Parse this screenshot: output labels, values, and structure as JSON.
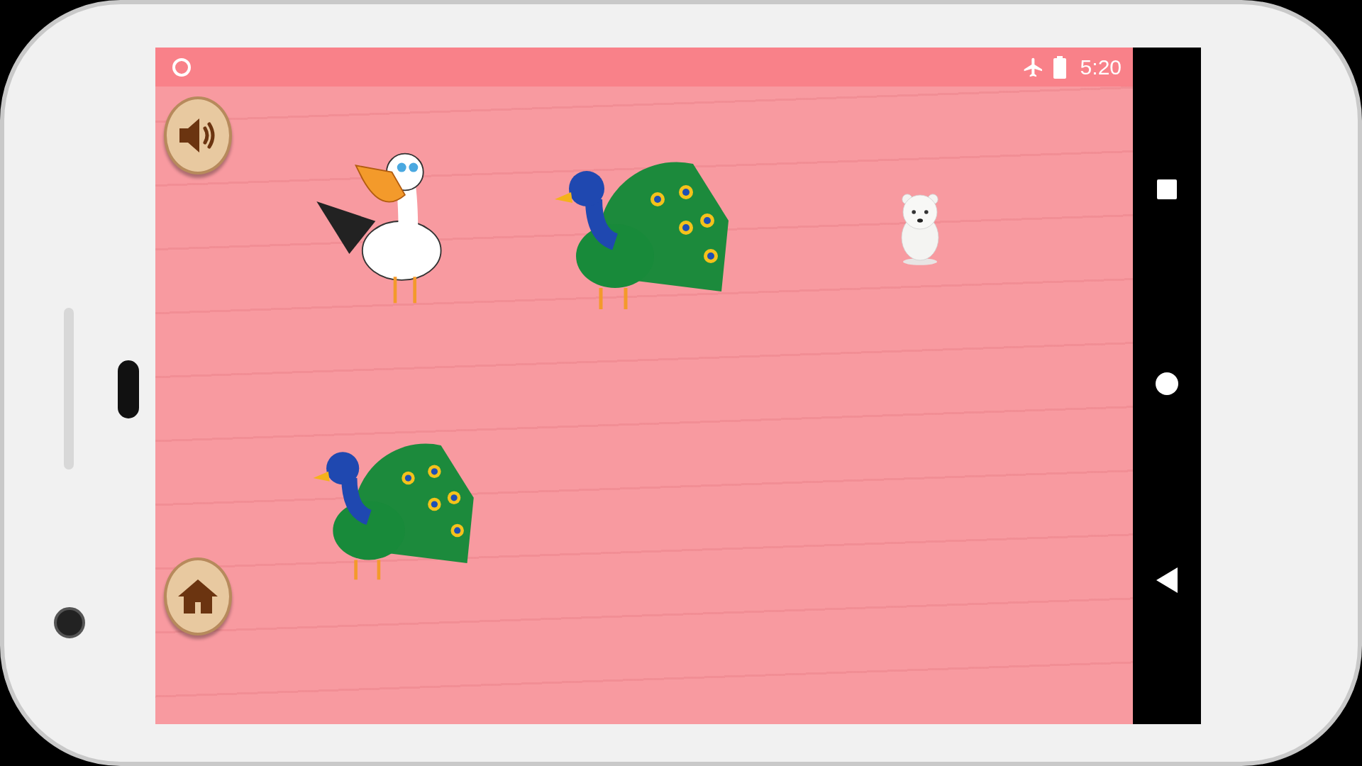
{
  "status_bar": {
    "time": "5:20"
  }
}
